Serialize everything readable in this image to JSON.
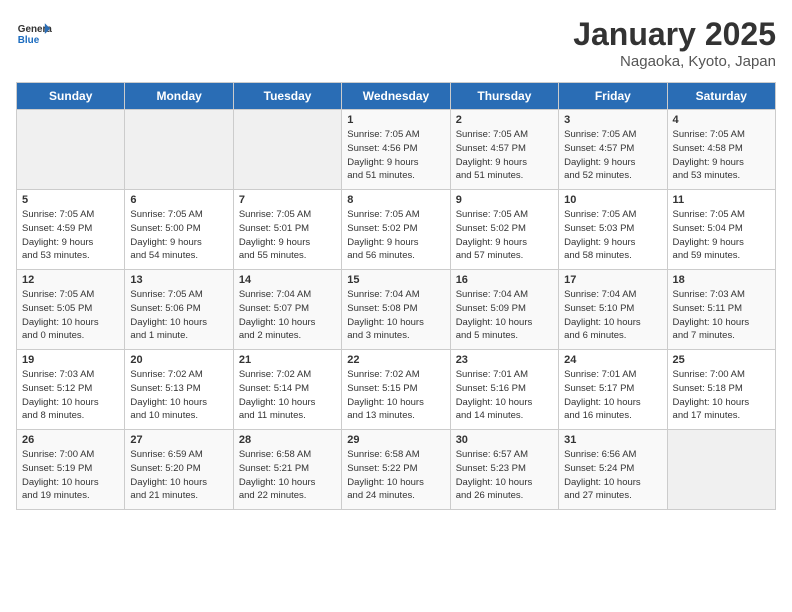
{
  "header": {
    "logo_general": "General",
    "logo_blue": "Blue",
    "title": "January 2025",
    "subtitle": "Nagaoka, Kyoto, Japan"
  },
  "days_of_week": [
    "Sunday",
    "Monday",
    "Tuesday",
    "Wednesday",
    "Thursday",
    "Friday",
    "Saturday"
  ],
  "weeks": [
    [
      {
        "num": "",
        "info": ""
      },
      {
        "num": "",
        "info": ""
      },
      {
        "num": "",
        "info": ""
      },
      {
        "num": "1",
        "info": "Sunrise: 7:05 AM\nSunset: 4:56 PM\nDaylight: 9 hours\nand 51 minutes."
      },
      {
        "num": "2",
        "info": "Sunrise: 7:05 AM\nSunset: 4:57 PM\nDaylight: 9 hours\nand 51 minutes."
      },
      {
        "num": "3",
        "info": "Sunrise: 7:05 AM\nSunset: 4:57 PM\nDaylight: 9 hours\nand 52 minutes."
      },
      {
        "num": "4",
        "info": "Sunrise: 7:05 AM\nSunset: 4:58 PM\nDaylight: 9 hours\nand 53 minutes."
      }
    ],
    [
      {
        "num": "5",
        "info": "Sunrise: 7:05 AM\nSunset: 4:59 PM\nDaylight: 9 hours\nand 53 minutes."
      },
      {
        "num": "6",
        "info": "Sunrise: 7:05 AM\nSunset: 5:00 PM\nDaylight: 9 hours\nand 54 minutes."
      },
      {
        "num": "7",
        "info": "Sunrise: 7:05 AM\nSunset: 5:01 PM\nDaylight: 9 hours\nand 55 minutes."
      },
      {
        "num": "8",
        "info": "Sunrise: 7:05 AM\nSunset: 5:02 PM\nDaylight: 9 hours\nand 56 minutes."
      },
      {
        "num": "9",
        "info": "Sunrise: 7:05 AM\nSunset: 5:02 PM\nDaylight: 9 hours\nand 57 minutes."
      },
      {
        "num": "10",
        "info": "Sunrise: 7:05 AM\nSunset: 5:03 PM\nDaylight: 9 hours\nand 58 minutes."
      },
      {
        "num": "11",
        "info": "Sunrise: 7:05 AM\nSunset: 5:04 PM\nDaylight: 9 hours\nand 59 minutes."
      }
    ],
    [
      {
        "num": "12",
        "info": "Sunrise: 7:05 AM\nSunset: 5:05 PM\nDaylight: 10 hours\nand 0 minutes."
      },
      {
        "num": "13",
        "info": "Sunrise: 7:05 AM\nSunset: 5:06 PM\nDaylight: 10 hours\nand 1 minute."
      },
      {
        "num": "14",
        "info": "Sunrise: 7:04 AM\nSunset: 5:07 PM\nDaylight: 10 hours\nand 2 minutes."
      },
      {
        "num": "15",
        "info": "Sunrise: 7:04 AM\nSunset: 5:08 PM\nDaylight: 10 hours\nand 3 minutes."
      },
      {
        "num": "16",
        "info": "Sunrise: 7:04 AM\nSunset: 5:09 PM\nDaylight: 10 hours\nand 5 minutes."
      },
      {
        "num": "17",
        "info": "Sunrise: 7:04 AM\nSunset: 5:10 PM\nDaylight: 10 hours\nand 6 minutes."
      },
      {
        "num": "18",
        "info": "Sunrise: 7:03 AM\nSunset: 5:11 PM\nDaylight: 10 hours\nand 7 minutes."
      }
    ],
    [
      {
        "num": "19",
        "info": "Sunrise: 7:03 AM\nSunset: 5:12 PM\nDaylight: 10 hours\nand 8 minutes."
      },
      {
        "num": "20",
        "info": "Sunrise: 7:02 AM\nSunset: 5:13 PM\nDaylight: 10 hours\nand 10 minutes."
      },
      {
        "num": "21",
        "info": "Sunrise: 7:02 AM\nSunset: 5:14 PM\nDaylight: 10 hours\nand 11 minutes."
      },
      {
        "num": "22",
        "info": "Sunrise: 7:02 AM\nSunset: 5:15 PM\nDaylight: 10 hours\nand 13 minutes."
      },
      {
        "num": "23",
        "info": "Sunrise: 7:01 AM\nSunset: 5:16 PM\nDaylight: 10 hours\nand 14 minutes."
      },
      {
        "num": "24",
        "info": "Sunrise: 7:01 AM\nSunset: 5:17 PM\nDaylight: 10 hours\nand 16 minutes."
      },
      {
        "num": "25",
        "info": "Sunrise: 7:00 AM\nSunset: 5:18 PM\nDaylight: 10 hours\nand 17 minutes."
      }
    ],
    [
      {
        "num": "26",
        "info": "Sunrise: 7:00 AM\nSunset: 5:19 PM\nDaylight: 10 hours\nand 19 minutes."
      },
      {
        "num": "27",
        "info": "Sunrise: 6:59 AM\nSunset: 5:20 PM\nDaylight: 10 hours\nand 21 minutes."
      },
      {
        "num": "28",
        "info": "Sunrise: 6:58 AM\nSunset: 5:21 PM\nDaylight: 10 hours\nand 22 minutes."
      },
      {
        "num": "29",
        "info": "Sunrise: 6:58 AM\nSunset: 5:22 PM\nDaylight: 10 hours\nand 24 minutes."
      },
      {
        "num": "30",
        "info": "Sunrise: 6:57 AM\nSunset: 5:23 PM\nDaylight: 10 hours\nand 26 minutes."
      },
      {
        "num": "31",
        "info": "Sunrise: 6:56 AM\nSunset: 5:24 PM\nDaylight: 10 hours\nand 27 minutes."
      },
      {
        "num": "",
        "info": ""
      }
    ]
  ]
}
